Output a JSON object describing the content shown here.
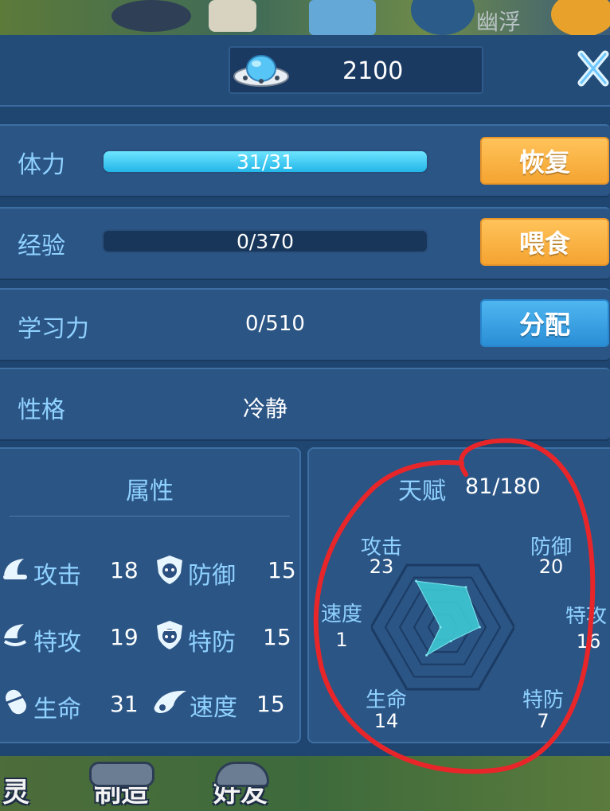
{
  "currency": {
    "icon": "ufo-icon",
    "value": "2100"
  },
  "background": {
    "side_label": "幽浮"
  },
  "stats": {
    "stamina": {
      "label": "体力",
      "value": "31/31",
      "fill": 1.0,
      "button": "恢复"
    },
    "experience": {
      "label": "经验",
      "value": "0/370",
      "fill": 0.0,
      "button": "喂食"
    },
    "learning": {
      "label": "学习力",
      "value": "0/510",
      "button": "分配"
    },
    "nature": {
      "label": "性格",
      "value": "冷静"
    }
  },
  "attributes": {
    "title": "属性",
    "items": [
      {
        "icon": "attack-icon",
        "label": "攻击",
        "value": "18"
      },
      {
        "icon": "defense-icon",
        "label": "防御",
        "value": "15"
      },
      {
        "icon": "special-attack-icon",
        "label": "特攻",
        "value": "19"
      },
      {
        "icon": "special-defense-icon",
        "label": "特防",
        "value": "15"
      },
      {
        "icon": "hp-icon",
        "label": "生命",
        "value": "31"
      },
      {
        "icon": "speed-icon",
        "label": "速度",
        "value": "15"
      }
    ]
  },
  "talent": {
    "title": "天赋",
    "value": "81/180",
    "axes": [
      {
        "label": "攻击",
        "value": "23"
      },
      {
        "label": "防御",
        "value": "20"
      },
      {
        "label": "特攻",
        "value": "16"
      },
      {
        "label": "特防",
        "value": "7"
      },
      {
        "label": "生命",
        "value": "14"
      },
      {
        "label": "速度",
        "value": "1"
      }
    ],
    "max_per_axis": 31
  },
  "bottom_nav": [
    {
      "label": "灵"
    },
    {
      "label": "制造"
    },
    {
      "label": "好友"
    }
  ],
  "colors": {
    "accent_text": "#8fd1ff",
    "orange_button": "#f5a431",
    "blue_button": "#2a8ed6",
    "radar_fill": "#3fd0d8",
    "annotation": "#e8262a"
  }
}
